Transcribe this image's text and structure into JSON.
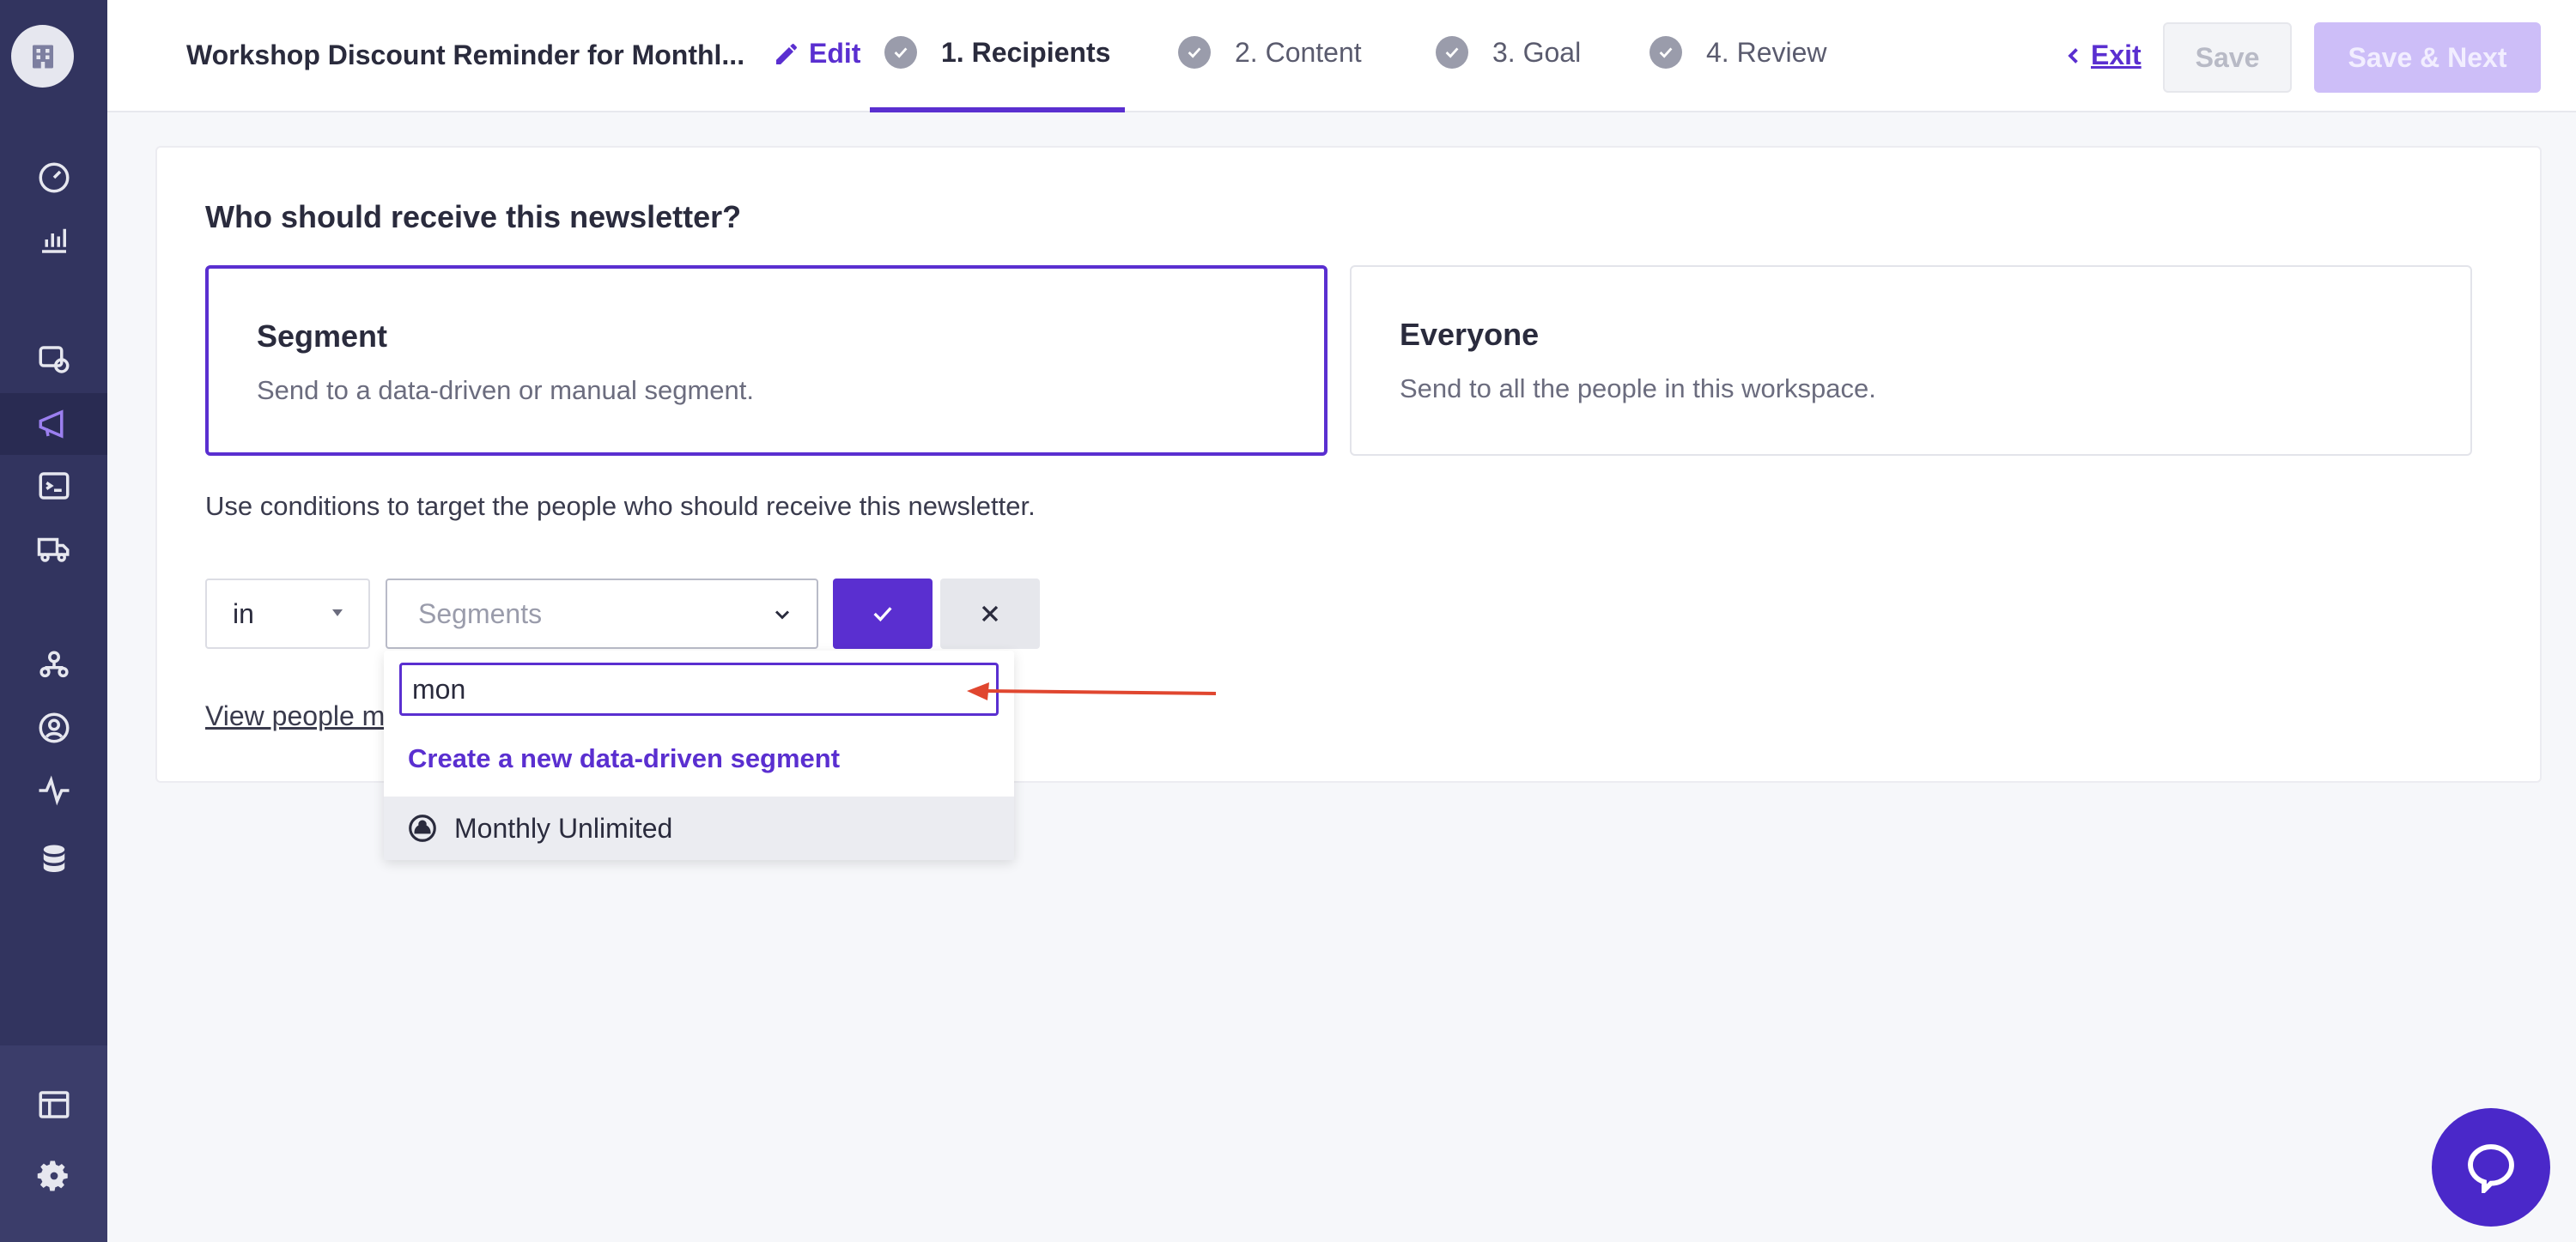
{
  "header": {
    "title": "Workshop Discount Reminder for Monthl...",
    "edit_label": "Edit",
    "steps": [
      {
        "label": "1. Recipients"
      },
      {
        "label": "2. Content"
      },
      {
        "label": "3. Goal"
      },
      {
        "label": "4. Review"
      }
    ],
    "exit_label": "Exit",
    "save_label": "Save",
    "save_next_label": "Save & Next"
  },
  "main": {
    "question": "Who should receive this newsletter?",
    "options": [
      {
        "title": "Segment",
        "description": "Send to a data-driven or manual segment."
      },
      {
        "title": "Everyone",
        "description": "Send to all the people in this workspace."
      }
    ],
    "conditions_text": "Use conditions to target the people who should receive this newsletter.",
    "operator_value": "in",
    "segments_placeholder": "Segments",
    "view_people_label": "View people m"
  },
  "dropdown": {
    "search_value": "mon",
    "create_label": "Create a new data-driven segment",
    "results": [
      {
        "label": "Monthly Unlimited"
      }
    ]
  },
  "colors": {
    "accent": "#5a2fd0",
    "sidebar": "#32345f",
    "annotation_arrow": "#e0462f"
  }
}
